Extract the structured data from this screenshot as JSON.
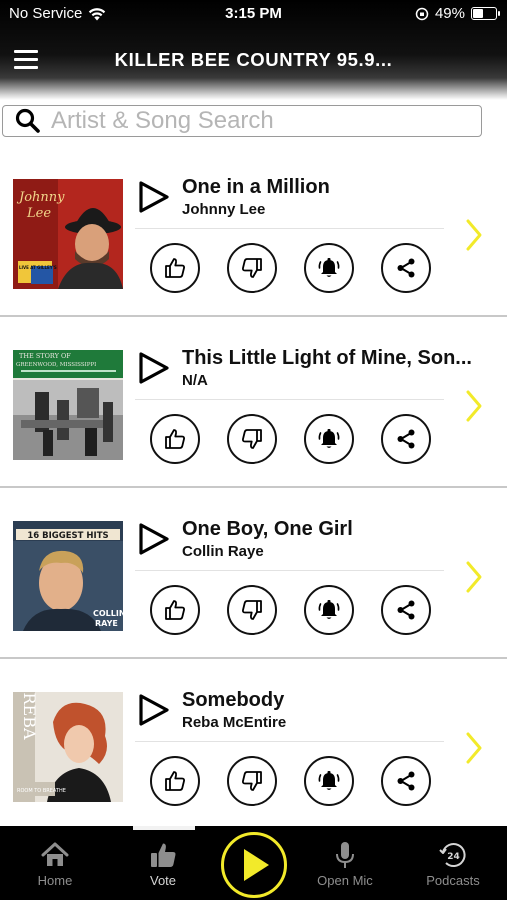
{
  "status_bar": {
    "carrier": "No Service",
    "time": "3:15 PM",
    "battery_percent": "49%",
    "battery_level": 0.49
  },
  "header": {
    "station_title": "KILLER BEE COUNTRY 95.9..."
  },
  "search": {
    "placeholder": "Artist & Song Search"
  },
  "songs": [
    {
      "title": "One in a Million",
      "artist": "Johnny Lee"
    },
    {
      "title": "This Little Light of Mine, Son...",
      "artist": "N/A"
    },
    {
      "title": "One Boy, One Girl",
      "artist": "Collin Raye"
    },
    {
      "title": "Somebody",
      "artist": "Reba McEntire"
    }
  ],
  "album_art_text": [
    {
      "line1": "Johnny",
      "line2": "Lee",
      "badge": "LIVE AT GILLEY'S"
    },
    {
      "line1": "THE STORY OF",
      "line2": "GREENWOOD, MISSISSIPPI"
    },
    {
      "line1": "16 BIGGEST HITS",
      "line2": "COLLIN",
      "line3": "RAYE"
    },
    {
      "line1": "REBA",
      "line2": "ROOM TO BREATHE"
    }
  ],
  "nav": {
    "home": "Home",
    "vote": "Vote",
    "open_mic": "Open Mic",
    "podcasts": "Podcasts",
    "podcasts_badge": "24"
  },
  "colors": {
    "accent_yellow": "#f2ea2a",
    "header_black": "#000000",
    "nav_background": "#000000"
  },
  "icons": {
    "action_buttons": [
      "thumbs-up-icon",
      "thumbs-down-icon",
      "alarm-bell-icon",
      "share-icon"
    ]
  }
}
